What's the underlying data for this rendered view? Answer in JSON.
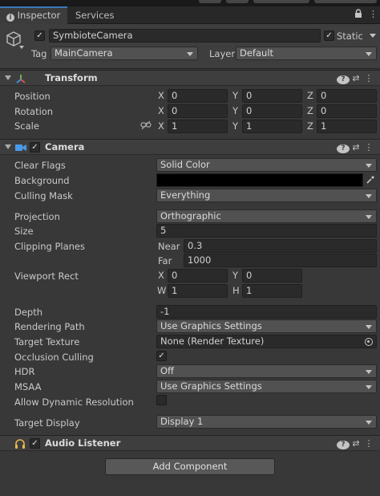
{
  "tabs": [
    {
      "label": "Inspector",
      "active": true
    },
    {
      "label": "Services",
      "active": false
    }
  ],
  "object": {
    "name": "SymbioteCamera",
    "active": true,
    "static_label": "Static",
    "static_checked": true,
    "tag_label": "Tag",
    "tag_value": "MainCamera",
    "layer_label": "Layer",
    "layer_value": "Default"
  },
  "transform": {
    "title": "Transform",
    "rows": [
      {
        "label": "Position",
        "x": "0",
        "y": "0",
        "z": "0"
      },
      {
        "label": "Rotation",
        "x": "0",
        "y": "0",
        "z": "0"
      },
      {
        "label": "Scale",
        "x": "1",
        "y": "1",
        "z": "1"
      }
    ],
    "axes": [
      "X",
      "Y",
      "Z"
    ]
  },
  "camera": {
    "title": "Camera",
    "enabled": true,
    "clear_flags": {
      "label": "Clear Flags",
      "value": "Solid Color"
    },
    "background": {
      "label": "Background",
      "color": "#000000"
    },
    "culling_mask": {
      "label": "Culling Mask",
      "value": "Everything"
    },
    "projection": {
      "label": "Projection",
      "value": "Orthographic"
    },
    "size": {
      "label": "Size",
      "value": "5"
    },
    "clipping": {
      "label": "Clipping Planes",
      "near_label": "Near",
      "near": "0.3",
      "far_label": "Far",
      "far": "1000"
    },
    "viewport": {
      "label": "Viewport Rect",
      "x_label": "X",
      "x": "0",
      "y_label": "Y",
      "y": "0",
      "w_label": "W",
      "w": "1",
      "h_label": "H",
      "h": "1"
    },
    "depth": {
      "label": "Depth",
      "value": "-1"
    },
    "rendering_path": {
      "label": "Rendering Path",
      "value": "Use Graphics Settings"
    },
    "target_texture": {
      "label": "Target Texture",
      "value": "None (Render Texture)"
    },
    "occlusion_culling": {
      "label": "Occlusion Culling",
      "checked": true
    },
    "hdr": {
      "label": "HDR",
      "value": "Off"
    },
    "msaa": {
      "label": "MSAA",
      "value": "Use Graphics Settings"
    },
    "dynamic_resolution": {
      "label": "Allow Dynamic Resolution",
      "checked": false
    },
    "target_display": {
      "label": "Target Display",
      "value": "Display 1"
    }
  },
  "audio_listener": {
    "title": "Audio Listener",
    "enabled": true
  },
  "add_component_label": "Add Component",
  "colors": {
    "accent": "#3a79bb",
    "panel": "#383838",
    "header": "#3e3e3e"
  }
}
